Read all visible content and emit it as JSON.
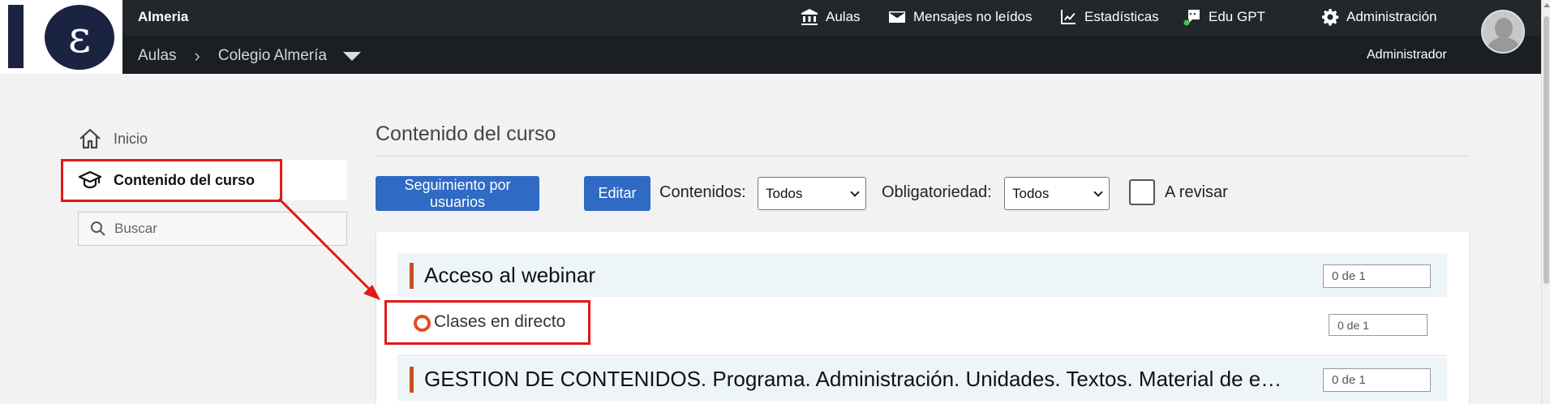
{
  "header": {
    "site_name": "Almeria",
    "nav": [
      {
        "label": "Aulas",
        "icon": "bank-icon"
      },
      {
        "label": "Mensajes no leídos",
        "icon": "envelope-icon"
      },
      {
        "label": "Estadísticas",
        "icon": "chart-line-icon"
      },
      {
        "label": "Edu GPT",
        "icon": "robot-chat-icon"
      },
      {
        "label": "Administración",
        "icon": "gear-icon"
      }
    ],
    "breadcrumb": [
      "Aulas",
      "Colegio Almería"
    ],
    "user_role": "Administrador"
  },
  "sidebar": {
    "items": [
      {
        "label": "Inicio",
        "icon": "home-icon"
      },
      {
        "label": "Contenido del curso",
        "icon": "graduation-cap-icon"
      }
    ],
    "search_placeholder": "Buscar"
  },
  "main": {
    "title": "Contenido del curso",
    "buttons": {
      "tracking": "Seguimiento por usuarios",
      "edit": "Editar"
    },
    "filters": {
      "contenidos_label": "Contenidos:",
      "contenidos_value": "Todos",
      "obligatoriedad_label": "Obligatoriedad:",
      "obligatoriedad_value": "Todos",
      "revisar_label": "A revisar"
    },
    "sections": [
      {
        "title": "Acceso al webinar",
        "progress": "0 de 1"
      },
      {
        "title": "GESTION DE CONTENIDOS. Programa. Administración. Unidades. Textos. Material de estudio",
        "progress": "0 de 1"
      }
    ],
    "items": [
      {
        "title": "Clases en directo",
        "progress": "0 de 1"
      }
    ]
  },
  "colors": {
    "header_bg": "#23272c",
    "primary_button": "#2f6ac4",
    "section_accent": "#c8511f",
    "status_ring": "#e64a19",
    "annotation": "#e11919"
  }
}
